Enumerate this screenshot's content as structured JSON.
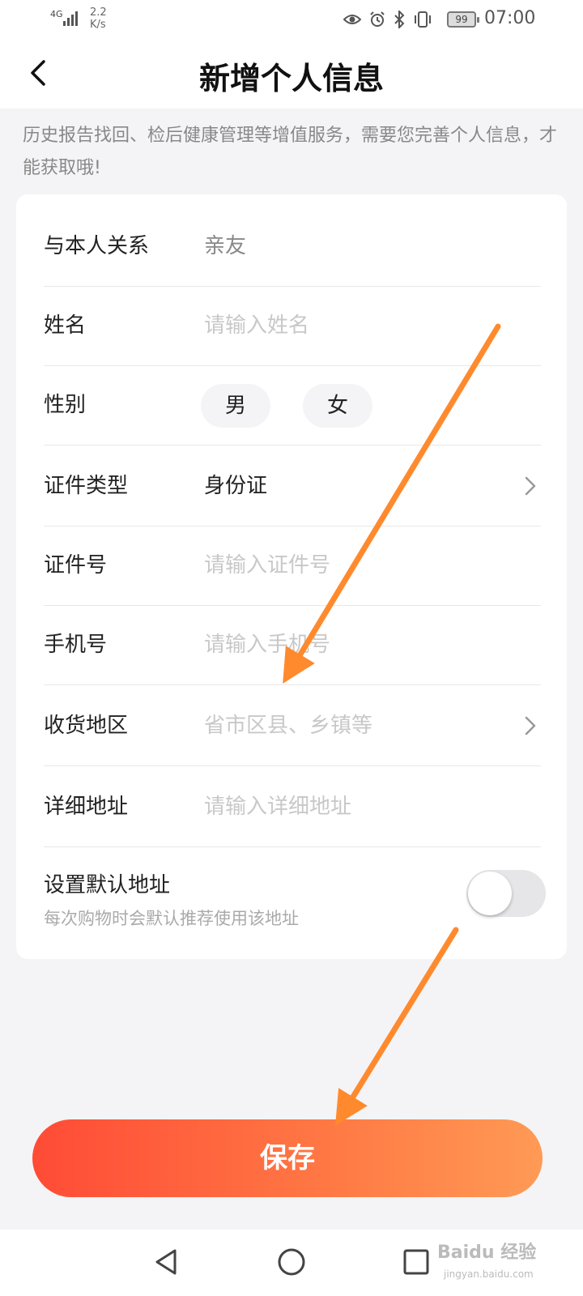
{
  "status_bar": {
    "network": "4G",
    "speed_value": "2.2",
    "speed_unit": "K/s",
    "battery": "99",
    "time": "07:00",
    "icons": [
      "eye-icon",
      "alarm-icon",
      "bluetooth-icon",
      "vibrate-icon"
    ]
  },
  "header": {
    "title": "新增个人信息"
  },
  "hint": "历史报告找回、检后健康管理等增值服务，需要您完善个人信息，才能获取哦!",
  "form": {
    "relation": {
      "label": "与本人关系",
      "value": "亲友"
    },
    "name": {
      "label": "姓名",
      "placeholder": "请输入姓名"
    },
    "gender": {
      "label": "性别",
      "options": [
        "男",
        "女"
      ]
    },
    "id_type": {
      "label": "证件类型",
      "value": "身份证"
    },
    "id_number": {
      "label": "证件号",
      "placeholder": "请输入证件号"
    },
    "phone": {
      "label": "手机号",
      "placeholder": "请输入手机号"
    },
    "region": {
      "label": "收货地区",
      "placeholder": "省市区县、乡镇等"
    },
    "address": {
      "label": "详细地址",
      "placeholder": "请输入详细地址"
    },
    "default_address": {
      "title": "设置默认地址",
      "subtitle": "每次购物时会默认推荐使用该地址",
      "enabled": false
    }
  },
  "save_label": "保存",
  "watermark": {
    "text": "Baidu 经验",
    "sub": "jingyan.baidu.com"
  },
  "colors": {
    "accent_start": "#ff4b36",
    "accent_end": "#ff9a55",
    "annotation_arrow": "#ff8a2e"
  }
}
